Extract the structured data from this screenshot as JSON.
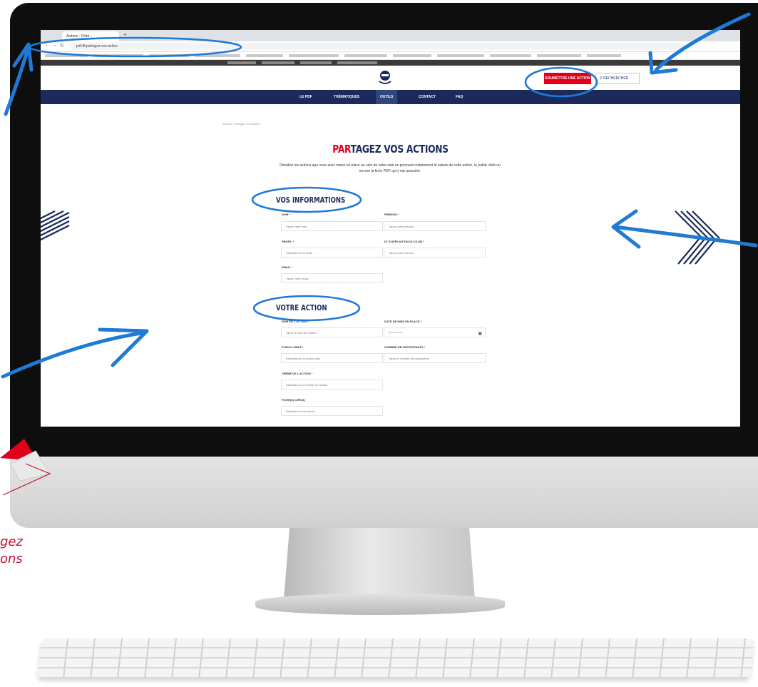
{
  "browser": {
    "tab_title": "Actions - Fédé...",
    "new_tab": "+",
    "url": "pdf.ffr/partagez-vos-action"
  },
  "site": {
    "cta_label": "SOUMETTRE UNE ACTION",
    "search_label": "RECHERCHER",
    "nav": [
      "LE PDF",
      "THÉMATIQUES",
      "OUTILS",
      "CONTACT",
      "FAQ"
    ],
    "breadcrumb": "Accueil / Partagez vos actions",
    "page_title_red": "PAR",
    "page_title_rest": "TAGEZ VOS ACTIONS",
    "intro_line1": "Détaillez les actions que vous avez mises en place au sein de votre club en précisant notamment la nature de cette action, le public ciblé ou",
    "intro_line2": "encore la fiche PDF qui y est associée."
  },
  "form": {
    "info_title": "VOS INFORMATIONS",
    "action_title": "VOTRE ACTION",
    "nom": {
      "label": "NOM *",
      "placeholder": "Tapez votre nom"
    },
    "prenom": {
      "label": "PRÉNOM *",
      "placeholder": "Tapez votre prénom"
    },
    "profil": {
      "label": "PROFIL *",
      "placeholder": "Sélectionnez le profil"
    },
    "club": {
      "label": "N° D'AFFILIATION DU CLUB *",
      "placeholder": "Tapez votre numéro"
    },
    "email": {
      "label": "EMAIL *",
      "placeholder": "Tapez votre email"
    },
    "action_nom": {
      "label": "NOM DE L'ACTION *",
      "placeholder": "Tapez le nom de l'action"
    },
    "date": {
      "label": "DATE DE MISE EN PLACE *",
      "placeholder": "jj/mm/aaaa"
    },
    "public": {
      "label": "PUBLIC CIBLÉ *",
      "placeholder": "Sélectionnez le public cible"
    },
    "participants": {
      "label": "NOMBRE DE PARTICIPANTS *",
      "placeholder": "Tapez le nombre de participants"
    },
    "theme": {
      "label": "THÈME DE L'ACTION *",
      "placeholder": "Sélectionnez le thème de l'action"
    },
    "fiches": {
      "label": "FICHE(S) LIÉE(S)",
      "placeholder": "Sélectionnez les fiches"
    }
  },
  "caption": {
    "line1": "gez",
    "line2": "ons"
  },
  "colors": {
    "navy": "#1b2a5a",
    "red": "#e2001a",
    "annotation_blue": "#1f7ad6",
    "caption_red": "#c8102e"
  }
}
